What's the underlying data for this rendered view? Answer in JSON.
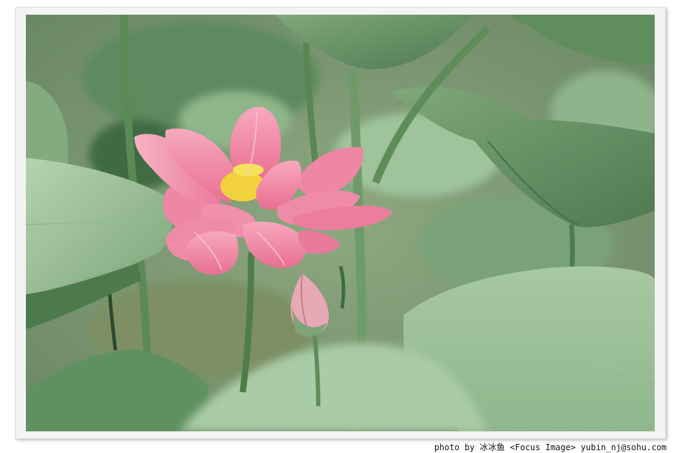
{
  "credit": {
    "text": "photo by 冰冰鱼 <Focus Image> yubin_nj@sohu.com"
  },
  "photo": {
    "subject": "lotus-flower-and-bud",
    "colors": {
      "background": "#7a9474",
      "leaf_light": "#a9c9a4",
      "leaf_mid": "#8fb58d",
      "leaf_dark": "#5f8a5e",
      "petal_pink": "#f08aa6",
      "petal_light": "#f7b9cb",
      "stamen_yellow": "#f2d23c"
    }
  }
}
